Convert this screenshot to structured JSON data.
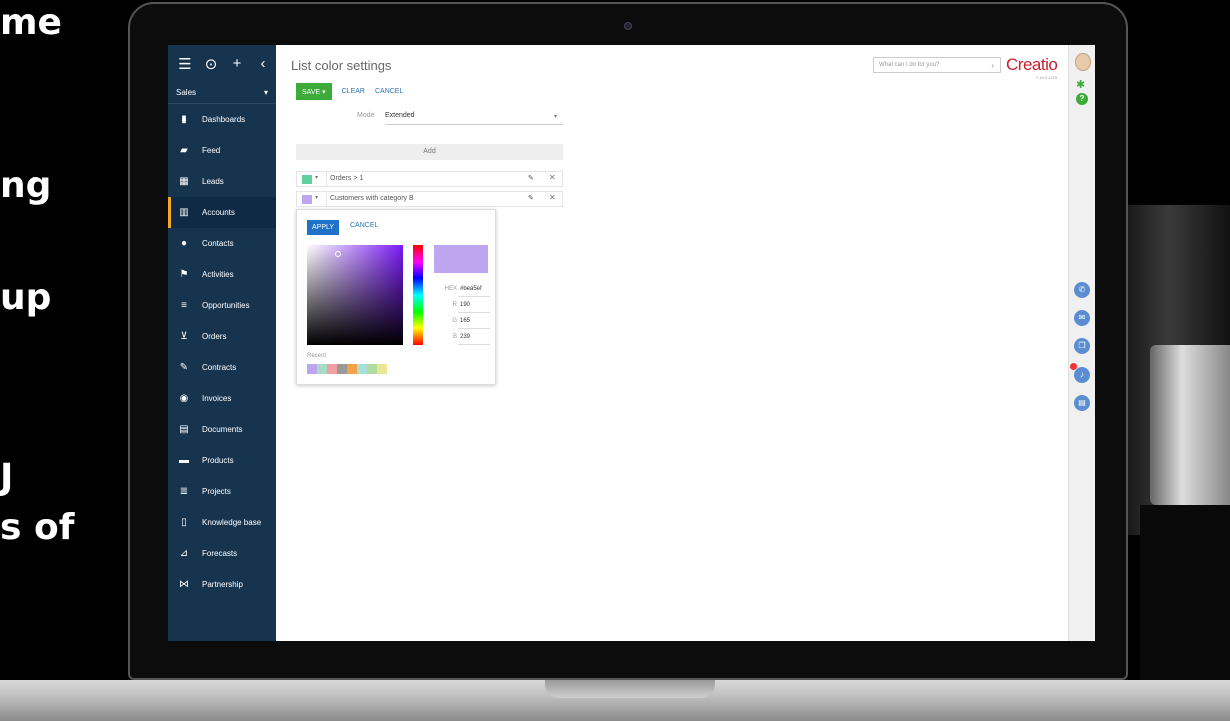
{
  "promo_fragments": [
    "me",
    "ng",
    "up",
    "J",
    "s of"
  ],
  "app": {
    "page_title": "List color settings",
    "search_placeholder": "What can I do for you?",
    "logo": "Creatio",
    "version": "7.16.0.1475"
  },
  "sidebar": {
    "section": "Sales",
    "items": [
      {
        "label": "Dashboards",
        "icon": "bar-chart-icon",
        "active": false
      },
      {
        "label": "Feed",
        "icon": "chat-icon",
        "active": false
      },
      {
        "label": "Leads",
        "icon": "leads-icon",
        "active": false
      },
      {
        "label": "Accounts",
        "icon": "building-icon",
        "active": true
      },
      {
        "label": "Contacts",
        "icon": "person-icon",
        "active": false
      },
      {
        "label": "Activities",
        "icon": "flag-icon",
        "active": false
      },
      {
        "label": "Opportunities",
        "icon": "funnel-icon",
        "active": false
      },
      {
        "label": "Orders",
        "icon": "cart-icon",
        "active": false
      },
      {
        "label": "Contracts",
        "icon": "contract-icon",
        "active": false
      },
      {
        "label": "Invoices",
        "icon": "invoice-icon",
        "active": false
      },
      {
        "label": "Documents",
        "icon": "document-icon",
        "active": false
      },
      {
        "label": "Products",
        "icon": "product-icon",
        "active": false
      },
      {
        "label": "Projects",
        "icon": "projects-icon",
        "active": false
      },
      {
        "label": "Knowledge base",
        "icon": "book-icon",
        "active": false
      },
      {
        "label": "Forecasts",
        "icon": "forecast-icon",
        "active": false
      },
      {
        "label": "Partnership",
        "icon": "handshake-icon",
        "active": false
      }
    ]
  },
  "toolbar": {
    "save": "SAVE",
    "clear": "CLEAR",
    "cancel": "CANCEL"
  },
  "mode": {
    "label": "Mode",
    "value": "Extended"
  },
  "add_label": "Add",
  "rules": [
    {
      "text": "Orders > 1",
      "color": "#5fd0a0"
    },
    {
      "text": "Customers with category B",
      "color": "#bea5ef"
    }
  ],
  "picker": {
    "apply": "APPLY",
    "cancel": "CANCEL",
    "preview_color": "#bea5ef",
    "hex_label": "HEX",
    "hex": "#bea5ef",
    "r_label": "R",
    "r": "190",
    "g_label": "G",
    "g": "165",
    "b_label": "B",
    "b": "239",
    "recent_label": "Recent",
    "recent_colors": [
      "#bea5ef",
      "#a8dcc8",
      "#f0a0a0",
      "#9a9a9a",
      "#f4a24a",
      "#a8e0d8",
      "#b0dca0",
      "#e8e890"
    ]
  }
}
